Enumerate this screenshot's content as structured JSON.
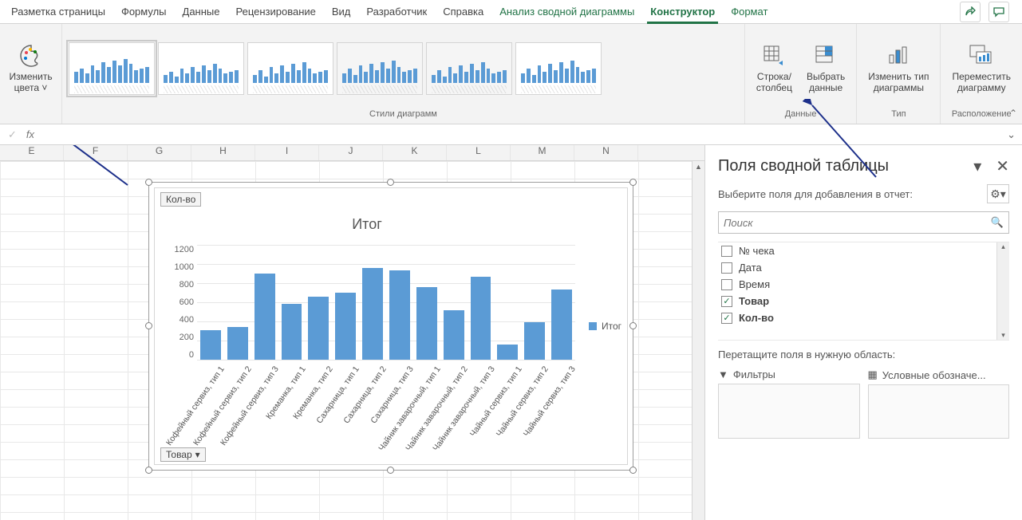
{
  "tabs": {
    "items": [
      "Разметка страницы",
      "Формулы",
      "Данные",
      "Рецензирование",
      "Вид",
      "Разработчик",
      "Справка",
      "Анализ сводной диаграммы",
      "Конструктор",
      "Формат"
    ],
    "context_start_index": 7,
    "active_index": 8
  },
  "ribbon": {
    "change_colors_l1": "Изменить",
    "change_colors_l2": "цвета",
    "styles_group": "Стили диаграмм",
    "data_group": "Данные",
    "switch_rc_l1": "Строка/",
    "switch_rc_l2": "столбец",
    "select_data_l1": "Выбрать",
    "select_data_l2": "данные",
    "type_group": "Тип",
    "change_type_l1": "Изменить тип",
    "change_type_l2": "диаграммы",
    "location_group": "Расположение",
    "move_chart_l1": "Переместить",
    "move_chart_l2": "диаграмму"
  },
  "formula_bar": {
    "fx": "fx"
  },
  "columns": [
    "E",
    "F",
    "G",
    "H",
    "I",
    "J",
    "K",
    "L",
    "M",
    "N"
  ],
  "pivot_buttons": {
    "top": "Кол-во",
    "bottom": "Товар"
  },
  "chart_data": {
    "type": "bar",
    "title": "Итог",
    "legend": "Итог",
    "ylim": [
      0,
      1200
    ],
    "ystep": 200,
    "categories": [
      "Кофейный сервиз, тип 1",
      "Кофейный сервиз, тип 2",
      "Кофейный сервиз, тип 3",
      "Креманка, тип 1",
      "Креманка, тип 2",
      "Сахарница, тип 1",
      "Сахарница, тип 2",
      "Сахарница, тип 3",
      "Чайник заварочный, тип 1",
      "Чайник заварочный, тип 2",
      "Чайник заварочный, тип 3",
      "Чайный сервиз, тип 1",
      "Чайный сервиз, тип 2",
      "Чайный сервиз, тип 3"
    ],
    "values": [
      310,
      340,
      900,
      580,
      660,
      700,
      960,
      930,
      760,
      520,
      870,
      160,
      390,
      730
    ]
  },
  "pt": {
    "title": "Поля сводной таблицы",
    "subtitle": "Выберите поля для добавления в отчет:",
    "search_placeholder": "Поиск",
    "fields": [
      {
        "label": "№ чека",
        "checked": false
      },
      {
        "label": "Дата",
        "checked": false
      },
      {
        "label": "Время",
        "checked": false
      },
      {
        "label": "Товар",
        "checked": true
      },
      {
        "label": "Кол-во",
        "checked": true
      }
    ],
    "drag_label": "Перетащите поля в нужную область:",
    "area_filters": "Фильтры",
    "area_legend": "Условные обозначе..."
  },
  "thumb_variants": [
    [
      14,
      18,
      12,
      22,
      16,
      26,
      20,
      28,
      22,
      30,
      24,
      16,
      18,
      20
    ],
    [
      10,
      14,
      8,
      18,
      12,
      20,
      14,
      22,
      16,
      24,
      18,
      12,
      14,
      16
    ],
    [
      10,
      16,
      8,
      20,
      12,
      22,
      14,
      24,
      16,
      26,
      18,
      12,
      14,
      16
    ],
    [
      12,
      18,
      10,
      22,
      14,
      24,
      16,
      26,
      18,
      28,
      20,
      14,
      16,
      18
    ],
    [
      10,
      16,
      8,
      20,
      12,
      22,
      14,
      24,
      16,
      26,
      18,
      12,
      14,
      16
    ],
    [
      12,
      18,
      10,
      22,
      14,
      24,
      16,
      26,
      18,
      28,
      20,
      14,
      16,
      18
    ]
  ]
}
